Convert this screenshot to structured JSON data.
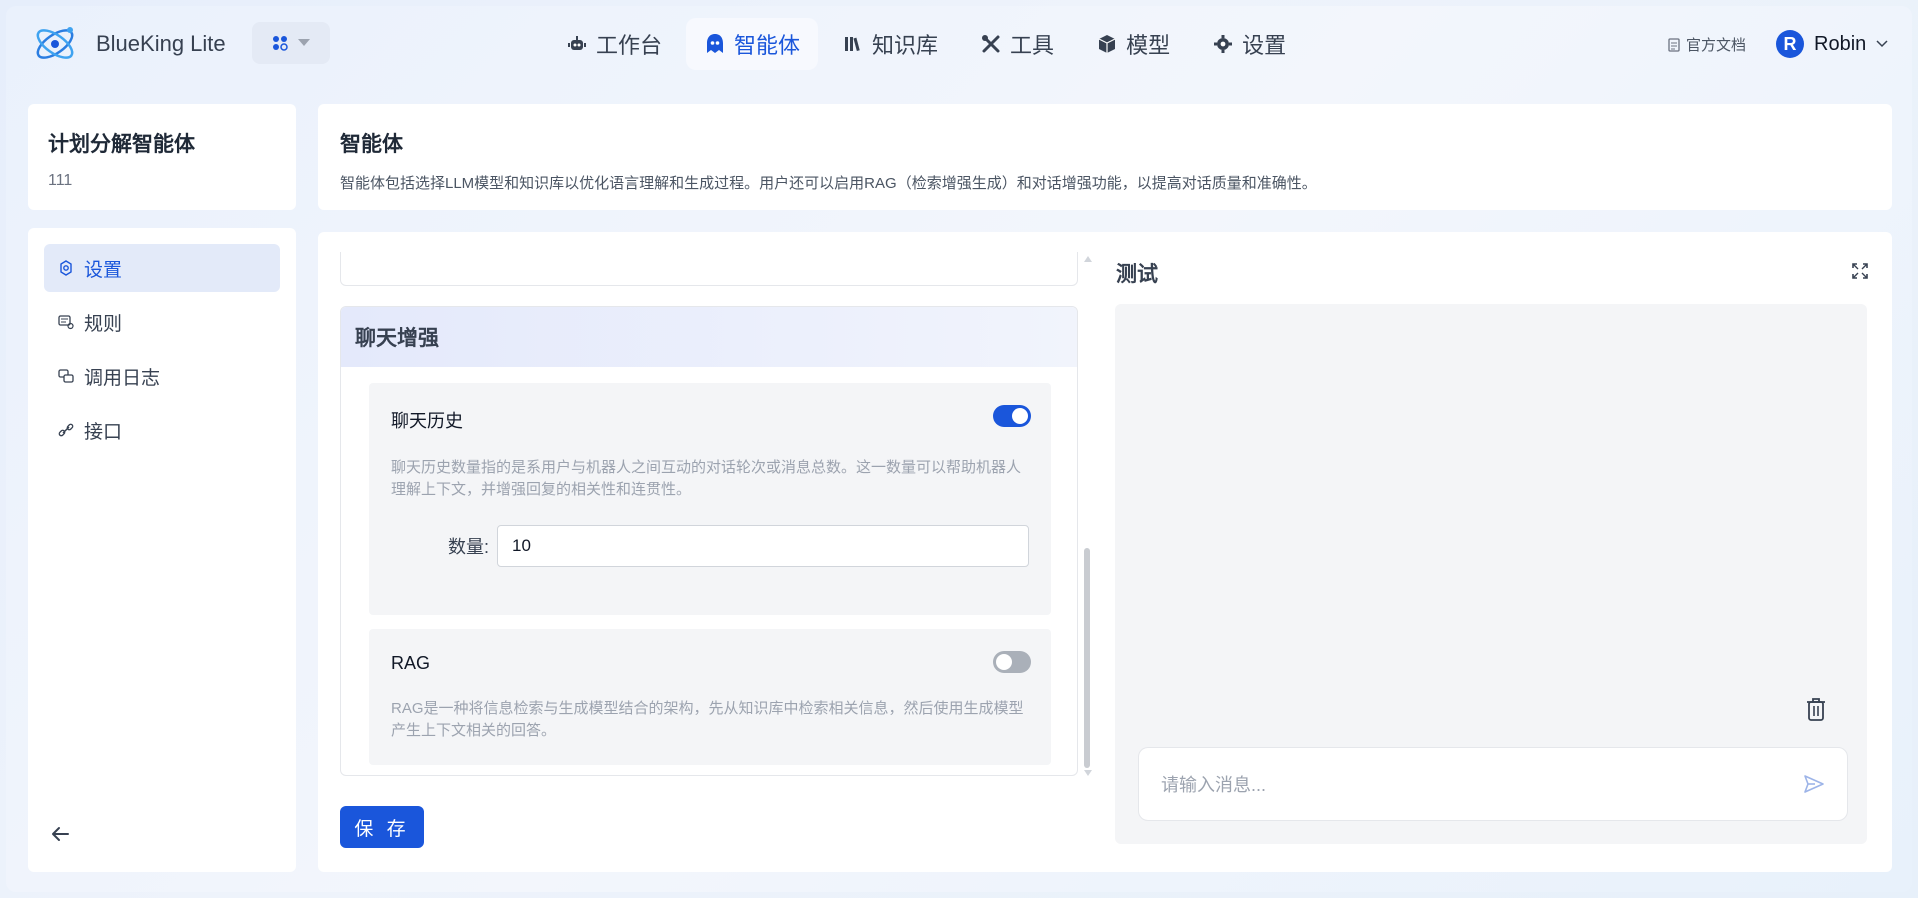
{
  "app": {
    "title": "BlueKing Lite"
  },
  "nav": [
    {
      "label": "工作台",
      "icon": "robot-icon",
      "active": false
    },
    {
      "label": "智能体",
      "icon": "agent-icon",
      "active": true
    },
    {
      "label": "知识库",
      "icon": "books-icon",
      "active": false
    },
    {
      "label": "工具",
      "icon": "tools-icon",
      "active": false
    },
    {
      "label": "模型",
      "icon": "cube-icon",
      "active": false
    },
    {
      "label": "设置",
      "icon": "gear-icon",
      "active": false
    }
  ],
  "header": {
    "docs_label": "官方文档",
    "user_initial": "R",
    "user_name": "Robin"
  },
  "agent": {
    "name": "计划分解智能体",
    "id": "111"
  },
  "sidebar": {
    "items": [
      {
        "label": "设置",
        "icon": "gear-outline-icon",
        "active": true
      },
      {
        "label": "规则",
        "icon": "rules-icon",
        "active": false
      },
      {
        "label": "调用日志",
        "icon": "log-icon",
        "active": false
      },
      {
        "label": "接口",
        "icon": "link-icon",
        "active": false
      }
    ]
  },
  "info": {
    "title": "智能体",
    "description": "智能体包括选择LLM模型和知识库以优化语言理解和生成过程。用户还可以启用RAG（检索增强生成）和对话增强功能，以提高对话质量和准确性。"
  },
  "chat_enhance": {
    "section_title": "聊天增强",
    "history": {
      "title": "聊天历史",
      "enabled": true,
      "description": "聊天历史数量指的是系用户与机器人之间互动的对话轮次或消息总数。这一数量可以帮助机器人理解上下文，并增强回复的相关性和连贯性。",
      "count_label": "数量:",
      "count_value": "10"
    },
    "rag": {
      "title": "RAG",
      "enabled": false,
      "description": "RAG是一种将信息检索与生成模型结合的架构，先从知识库中检索相关信息，然后使用生成模型产生上下文相关的回答。"
    }
  },
  "actions": {
    "save_label": "保 存"
  },
  "test": {
    "title": "测试",
    "input_placeholder": "请输入消息..."
  },
  "colors": {
    "accent": "#1a56db",
    "toggle_off": "#aab0b9"
  }
}
